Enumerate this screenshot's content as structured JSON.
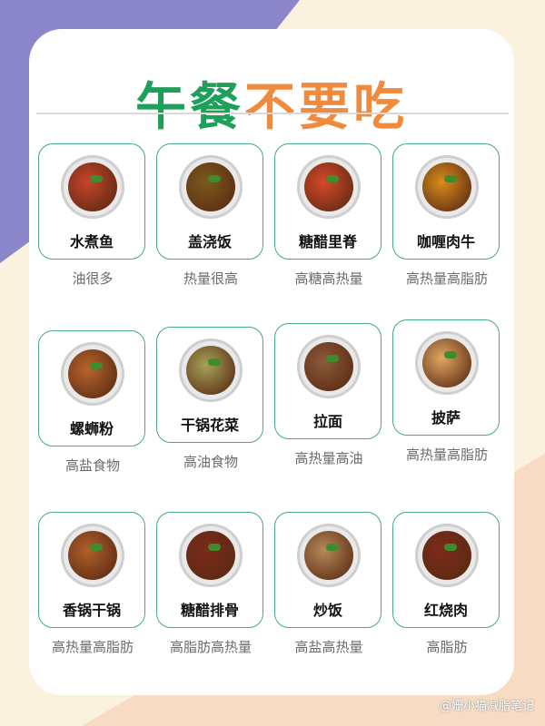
{
  "title": {
    "part1": "午餐",
    "part2": "不要吃"
  },
  "items": [
    {
      "name": "水煮鱼",
      "note": "油很多",
      "icon": "boiled-fish-icon",
      "color": "#c8432b"
    },
    {
      "name": "盖浇饭",
      "note": "热量很高",
      "icon": "rice-bowl-icon",
      "color": "#7b5a1e"
    },
    {
      "name": "糖醋里脊",
      "note": "高糖高热量",
      "icon": "sweet-sour-pork-icon",
      "color": "#d9482a"
    },
    {
      "name": "咖喱肉牛",
      "note": "高热量高脂肪",
      "icon": "curry-beef-icon",
      "color": "#d98c1a"
    },
    {
      "name": "螺蛳粉",
      "note": "高盐食物",
      "icon": "snail-noodles-icon",
      "color": "#b8652c"
    },
    {
      "name": "干锅花菜",
      "note": "高油食物",
      "icon": "cauliflower-icon",
      "color": "#a6a35a"
    },
    {
      "name": "拉面",
      "note": "高热量高油",
      "icon": "ramen-icon",
      "color": "#8b5a3a"
    },
    {
      "name": "披萨",
      "note": "高热量高脂肪",
      "icon": "pizza-icon",
      "color": "#e0a862"
    },
    {
      "name": "香锅干锅",
      "note": "高热量高脂肪",
      "icon": "dry-pot-icon",
      "color": "#b0602a"
    },
    {
      "name": "糖醋排骨",
      "note": "高脂肪高热量",
      "icon": "spare-ribs-icon",
      "color": "#7a2a1a"
    },
    {
      "name": "炒饭",
      "note": "高盐高热量",
      "icon": "fried-rice-icon",
      "color": "#b68a5a"
    },
    {
      "name": "红烧肉",
      "note": "高脂肪",
      "icon": "braised-pork-icon",
      "color": "#7c2b1b"
    }
  ],
  "watermark": "@姗小猫减脂笔记"
}
